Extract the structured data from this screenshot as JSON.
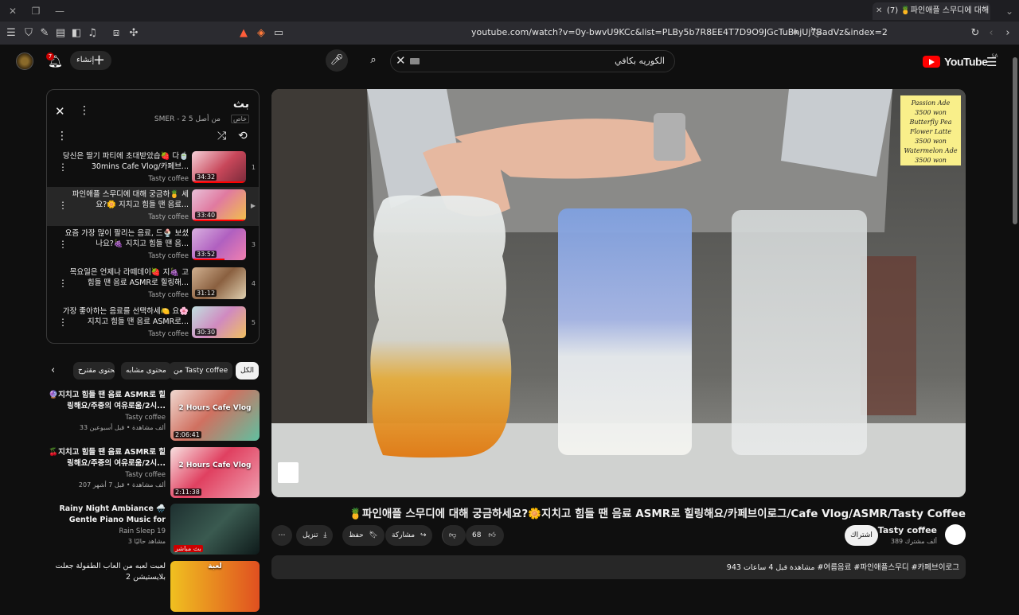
{
  "browser": {
    "tab_title": "(7) 🍍파인애플 스무디에 대해",
    "url": "youtube.com/watch?v=0y-bwvU9KCc&list=PLBy5b7R8EE4T7D9O9JGcTuBhjUj7BadVz&index=2"
  },
  "header": {
    "create_label": "إنشاء",
    "notif_count": "7",
    "search_value": "الكوريه بكافي",
    "logo_text": "YouTube",
    "logo_region": "SA"
  },
  "playlist": {
    "title": "بث",
    "subtitle": "SMER - 2 من أصل 5",
    "privacy": "خاص",
    "items": [
      {
        "num": "1",
        "title": "당신은 딸기 파티에 초대받았습🍓 다🍵 30mins Cafe Vlog/카페브...",
        "channel": "Tasty coffee",
        "duration": "34:32"
      },
      {
        "num": "▶",
        "title": "파인애플 스무디에 대해 궁금하🍍 세요?🌼 지치고 힘들 땐 음료...",
        "channel": "Tasty coffee",
        "duration": "33:40"
      },
      {
        "num": "3",
        "title": "요즘 가장 많이 팔리는 음료, 드🍨 보셨나요?🍇 지치고 힘들 땐 음...",
        "channel": "Tasty coffee",
        "duration": "33:52"
      },
      {
        "num": "4",
        "title": "목요일은 언제나 라떼데이🍓 지🍇 고 힘들 땐 음료 ASMR로 힐링해...",
        "channel": "Tasty coffee",
        "duration": "31:12"
      },
      {
        "num": "5",
        "title": "가장 좋아하는 음료를 선택하세🍋 요🌸 지치고 힘들 땐 음료 ASMR로...",
        "channel": "Tasty coffee",
        "duration": "30:30"
      }
    ]
  },
  "chips": [
    "الكل",
    "من Tasty coffee",
    "محتوى مشابه",
    "محتوى مقترح"
  ],
  "related": [
    {
      "title": "🔮지치고 힘들 땐 음료 ASMR로 힐링해요/주중의 여유로움/2시...",
      "channel": "Tasty coffee",
      "meta": "33 ألف مشاهدة • قبل أسبوعين",
      "duration": "2:06:41",
      "thumb_text": "2 Hours Cafe Vlog"
    },
    {
      "title": "🍒지치고 힘들 땐 음료 ASMR로 힐링해요/주중의 여유로움/2시...",
      "channel": "Tasty coffee",
      "meta": "207 ألف مشاهدة • قبل 7 أشهر",
      "duration": "2:11:38",
      "thumb_text": "2 Hours Cafe Vlog"
    },
    {
      "title": "Rainy Night Ambiance 🌧️ Gentle Piano Music for Deep...",
      "channel": "Rain Sleep 19",
      "meta": "3 مشاهد حاليًا",
      "duration": "بث مباشر",
      "thumb_text": ""
    },
    {
      "title": "لعبت لعبه من العاب الطفولة جعلت بلايستيشن 2",
      "channel": "",
      "meta": "",
      "duration": "",
      "thumb_text": "لعبة"
    }
  ],
  "player": {
    "note_lines": [
      "Passion Ade",
      "3500 won",
      "Butterfly Pea",
      "Flower Latte",
      "3500 won",
      "Watermelon Ade",
      "3500 won"
    ]
  },
  "video": {
    "title": "🍍파인애플 스무디에 대해 궁금하세요?🌼지치고 힘들 땐 음료 ASMR로 힐링해요/카페브이로그/Cafe Vlog/ASMR/Tasty Coffee",
    "channel": "Tasty coffee",
    "subscribers": "389 ألف مشترك",
    "subscribe_label": "اشتراك",
    "likes": "68",
    "share_label": "مشاركة",
    "save_label": "حفظ",
    "download_label": "تنزيل",
    "description": "943 مشاهدة قبل 4 ساعات  #여름음료 #파인애플스무디 #카페브이로그"
  },
  "colors": {
    "accent": "#ff0000",
    "bg": "#0f0f0f",
    "surface": "#272727"
  }
}
